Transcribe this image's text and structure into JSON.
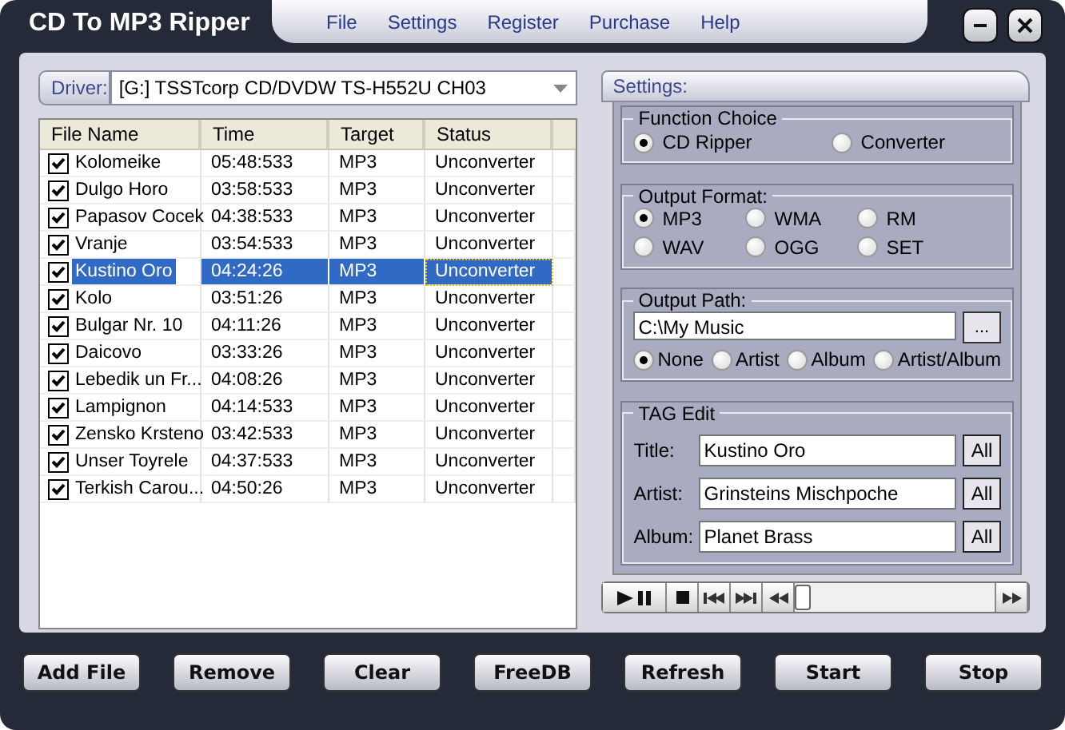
{
  "window": {
    "title": "CD To MP3 Ripper"
  },
  "menu": [
    "File",
    "Settings",
    "Register",
    "Purchase",
    "Help"
  ],
  "driver": {
    "label": "Driver:",
    "value": "[G:]  TSSTcorp  CD/DVDW TS-H552U  CH03"
  },
  "table": {
    "columns": [
      "File  Name",
      "Time",
      "Target",
      "Status"
    ],
    "rows": [
      {
        "name": "Kolomeike",
        "time": "05:48:533",
        "target": "MP3",
        "status": "Unconverter",
        "checked": true,
        "selected": false
      },
      {
        "name": "Dulgo Horo",
        "time": "03:58:533",
        "target": "MP3",
        "status": "Unconverter",
        "checked": true,
        "selected": false
      },
      {
        "name": "Papasov Cocek",
        "time": "04:38:533",
        "target": "MP3",
        "status": "Unconverter",
        "checked": true,
        "selected": false
      },
      {
        "name": "Vranje",
        "time": "03:54:533",
        "target": "MP3",
        "status": "Unconverter",
        "checked": true,
        "selected": false
      },
      {
        "name": "Kustino Oro",
        "time": "04:24:26",
        "target": "MP3",
        "status": "Unconverter",
        "checked": true,
        "selected": true
      },
      {
        "name": "Kolo",
        "time": "03:51:26",
        "target": "MP3",
        "status": "Unconverter",
        "checked": true,
        "selected": false
      },
      {
        "name": "Bulgar Nr. 10",
        "time": "04:11:26",
        "target": "MP3",
        "status": "Unconverter",
        "checked": true,
        "selected": false
      },
      {
        "name": "Daicovo",
        "time": "03:33:26",
        "target": "MP3",
        "status": "Unconverter",
        "checked": true,
        "selected": false
      },
      {
        "name": "Lebedik un Fr...",
        "time": "04:08:26",
        "target": "MP3",
        "status": "Unconverter",
        "checked": true,
        "selected": false
      },
      {
        "name": "Lampignon",
        "time": "04:14:533",
        "target": "MP3",
        "status": "Unconverter",
        "checked": true,
        "selected": false
      },
      {
        "name": "Zensko Krsteno",
        "time": "03:42:533",
        "target": "MP3",
        "status": "Unconverter",
        "checked": true,
        "selected": false
      },
      {
        "name": "Unser Toyrele",
        "time": "04:37:533",
        "target": "MP3",
        "status": "Unconverter",
        "checked": true,
        "selected": false
      },
      {
        "name": "Terkish Carou...",
        "time": "04:50:26",
        "target": "MP3",
        "status": "Unconverter",
        "checked": true,
        "selected": false
      }
    ]
  },
  "settings": {
    "title": "Settings:",
    "function_choice": {
      "title": "Function Choice",
      "options": [
        {
          "label": "CD Ripper",
          "selected": true
        },
        {
          "label": "Converter",
          "selected": false
        }
      ]
    },
    "output_format": {
      "title": "Output Format:",
      "options": [
        {
          "label": "MP3",
          "selected": true
        },
        {
          "label": "WMA",
          "selected": false
        },
        {
          "label": "RM",
          "selected": false
        },
        {
          "label": "WAV",
          "selected": false
        },
        {
          "label": "OGG",
          "selected": false
        },
        {
          "label": "SET",
          "selected": false
        }
      ]
    },
    "output_path": {
      "title": "Output Path:",
      "value": "C:\\My Music",
      "browse": "...",
      "options": [
        {
          "label": "None",
          "selected": true
        },
        {
          "label": "Artist",
          "selected": false
        },
        {
          "label": "Album",
          "selected": false
        },
        {
          "label": "Artist/Album",
          "selected": false
        }
      ]
    },
    "tag_edit": {
      "title": "TAG Edit",
      "fields": [
        {
          "label": "Title:",
          "value": "Kustino Oro",
          "button": "All"
        },
        {
          "label": "Artist:",
          "value": "Grinsteins Mischpoche",
          "button": "All"
        },
        {
          "label": "Album:",
          "value": "Planet Brass",
          "button": "All"
        }
      ]
    }
  },
  "player": {
    "seek": {
      "level": 0
    }
  },
  "buttons": [
    "Add File",
    "Remove",
    "Clear",
    "FreeDB",
    "Refresh",
    "Start",
    "Stop"
  ]
}
